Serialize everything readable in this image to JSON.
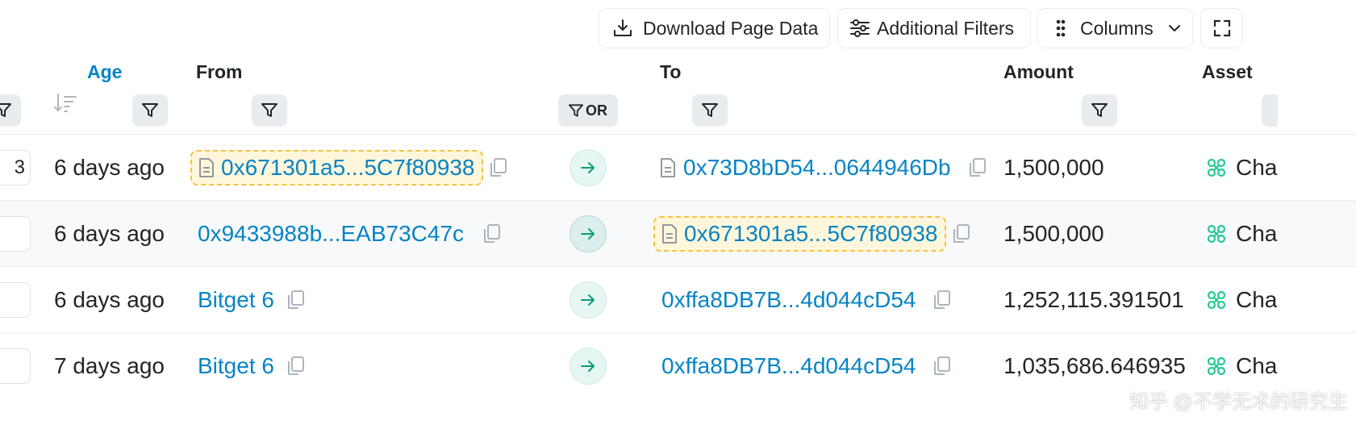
{
  "toolbar": {
    "download_label": "Download Page Data",
    "filters_label": "Additional Filters",
    "columns_label": "Columns"
  },
  "table": {
    "headers": {
      "age": "Age",
      "from": "From",
      "or": "OR",
      "to": "To",
      "amount": "Amount",
      "asset": "Asset"
    },
    "rows": [
      {
        "left_value": "3",
        "age": "6 days ago",
        "from": "0x671301a5...5C7f80938",
        "to": "0x73D8bD54...0644946Db",
        "amount": "1,500,000",
        "asset": "Cha"
      },
      {
        "left_value": "",
        "age": "6 days ago",
        "from": "0x9433988b...EAB73C47c",
        "to": "0x671301a5...5C7f80938",
        "amount": "1,500,000",
        "asset": "Cha"
      },
      {
        "left_value": "",
        "age": "6 days ago",
        "from": "Bitget 6",
        "to": "0xffa8DB7B...4d044cD54",
        "amount": "1,252,115.391501",
        "asset": "Cha"
      },
      {
        "left_value": "",
        "age": "7 days ago",
        "from": "Bitget 6",
        "to": "0xffa8DB7B...4d044cD54",
        "amount": "1,035,686.646935",
        "asset": "Cha"
      }
    ]
  },
  "watermark": "知乎 @不学无术的研究生",
  "colors": {
    "link": "#0784c3",
    "highlight_bg": "#fff6dc",
    "highlight_border": "#f5c342",
    "arrow_green": "#0a9f75",
    "asset_icon": "#27c995"
  }
}
